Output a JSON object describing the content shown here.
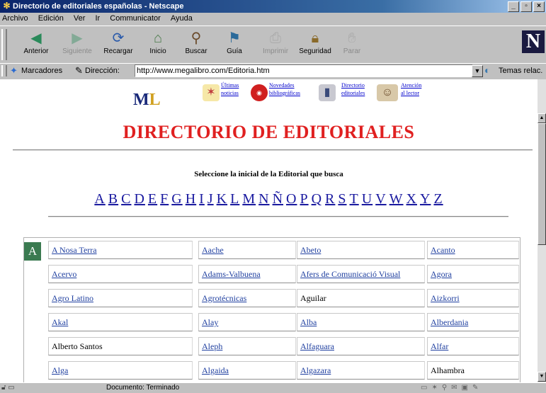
{
  "window": {
    "title": "Directorio de editoriales españolas - Netscape"
  },
  "menu": [
    "Archivo",
    "Edición",
    "Ver",
    "Ir",
    "Communicator",
    "Ayuda"
  ],
  "toolbar": [
    {
      "label": "Anterior",
      "icon": "back-arrow-icon",
      "enabled": true
    },
    {
      "label": "Siguiente",
      "icon": "forward-arrow-icon",
      "enabled": false
    },
    {
      "label": "Recargar",
      "icon": "reload-icon",
      "enabled": true
    },
    {
      "label": "Inicio",
      "icon": "home-icon",
      "enabled": true
    },
    {
      "label": "Buscar",
      "icon": "search-icon",
      "enabled": true
    },
    {
      "label": "Guía",
      "icon": "guide-icon",
      "enabled": true
    },
    {
      "label": "Imprimir",
      "icon": "print-icon",
      "enabled": false
    },
    {
      "label": "Seguridad",
      "icon": "lock-icon",
      "enabled": true
    },
    {
      "label": "Parar",
      "icon": "stop-icon",
      "enabled": false
    }
  ],
  "location": {
    "bookmarks_label": "Marcadores",
    "address_label": "Dirección:",
    "url": "http://www.megalibro.com/Editoria.htm",
    "related_label": "Temas relac."
  },
  "page": {
    "logo_text": "M",
    "logo_accent": "L",
    "nav": [
      {
        "line1": "Últimas",
        "line2": "noticias"
      },
      {
        "line1": "Novedades",
        "line2": "bibliográficas"
      },
      {
        "line1": "Directorio",
        "line2": "editoriales"
      },
      {
        "line1": "Atención",
        "line2": "al lector"
      }
    ],
    "heading": "DIRECTORIO DE EDITORIALES",
    "prompt": "Seleccione la inicial de la Editorial que busca",
    "letters": [
      "A",
      "B",
      "C",
      "D",
      "E",
      "F",
      "G",
      "H",
      "I",
      "J",
      "K",
      "L",
      "M",
      "N",
      "Ñ",
      "O",
      "P",
      "Q",
      "R",
      "S",
      "T",
      "U",
      "V",
      "W",
      "X",
      "Y",
      "Z"
    ],
    "section_letter": "A",
    "publishers": [
      [
        {
          "name": "A Nosa Terra",
          "link": true
        },
        {
          "name": "Aache",
          "link": true
        },
        {
          "name": "Abeto",
          "link": true
        },
        {
          "name": "Acanto",
          "link": true
        }
      ],
      [
        {
          "name": "Acervo",
          "link": true
        },
        {
          "name": "Adams-Valbuena",
          "link": true
        },
        {
          "name": "Afers de Comunicació Visual",
          "link": true
        },
        {
          "name": "Agora",
          "link": true
        }
      ],
      [
        {
          "name": "Agro Latino",
          "link": true
        },
        {
          "name": "Agrotécnicas",
          "link": true
        },
        {
          "name": "Aguilar",
          "link": false
        },
        {
          "name": "Aizkorri",
          "link": true
        }
      ],
      [
        {
          "name": "Akal",
          "link": true
        },
        {
          "name": "Alay",
          "link": true
        },
        {
          "name": "Alba",
          "link": true
        },
        {
          "name": "Alberdania",
          "link": true
        }
      ],
      [
        {
          "name": "Alberto Santos",
          "link": false
        },
        {
          "name": "Aleph",
          "link": true
        },
        {
          "name": "Alfaguara",
          "link": true
        },
        {
          "name": "Alfar",
          "link": true
        }
      ],
      [
        {
          "name": "Alga",
          "link": true
        },
        {
          "name": "Algaida",
          "link": true
        },
        {
          "name": "Algazara",
          "link": true
        },
        {
          "name": "Alhambra",
          "link": false
        }
      ]
    ]
  },
  "status": {
    "text": "Documento: Terminado"
  },
  "colors": {
    "heading": "#e02020",
    "link": "#2040a0",
    "badge": "#3a7a50",
    "titlebar": "#0a246a"
  }
}
